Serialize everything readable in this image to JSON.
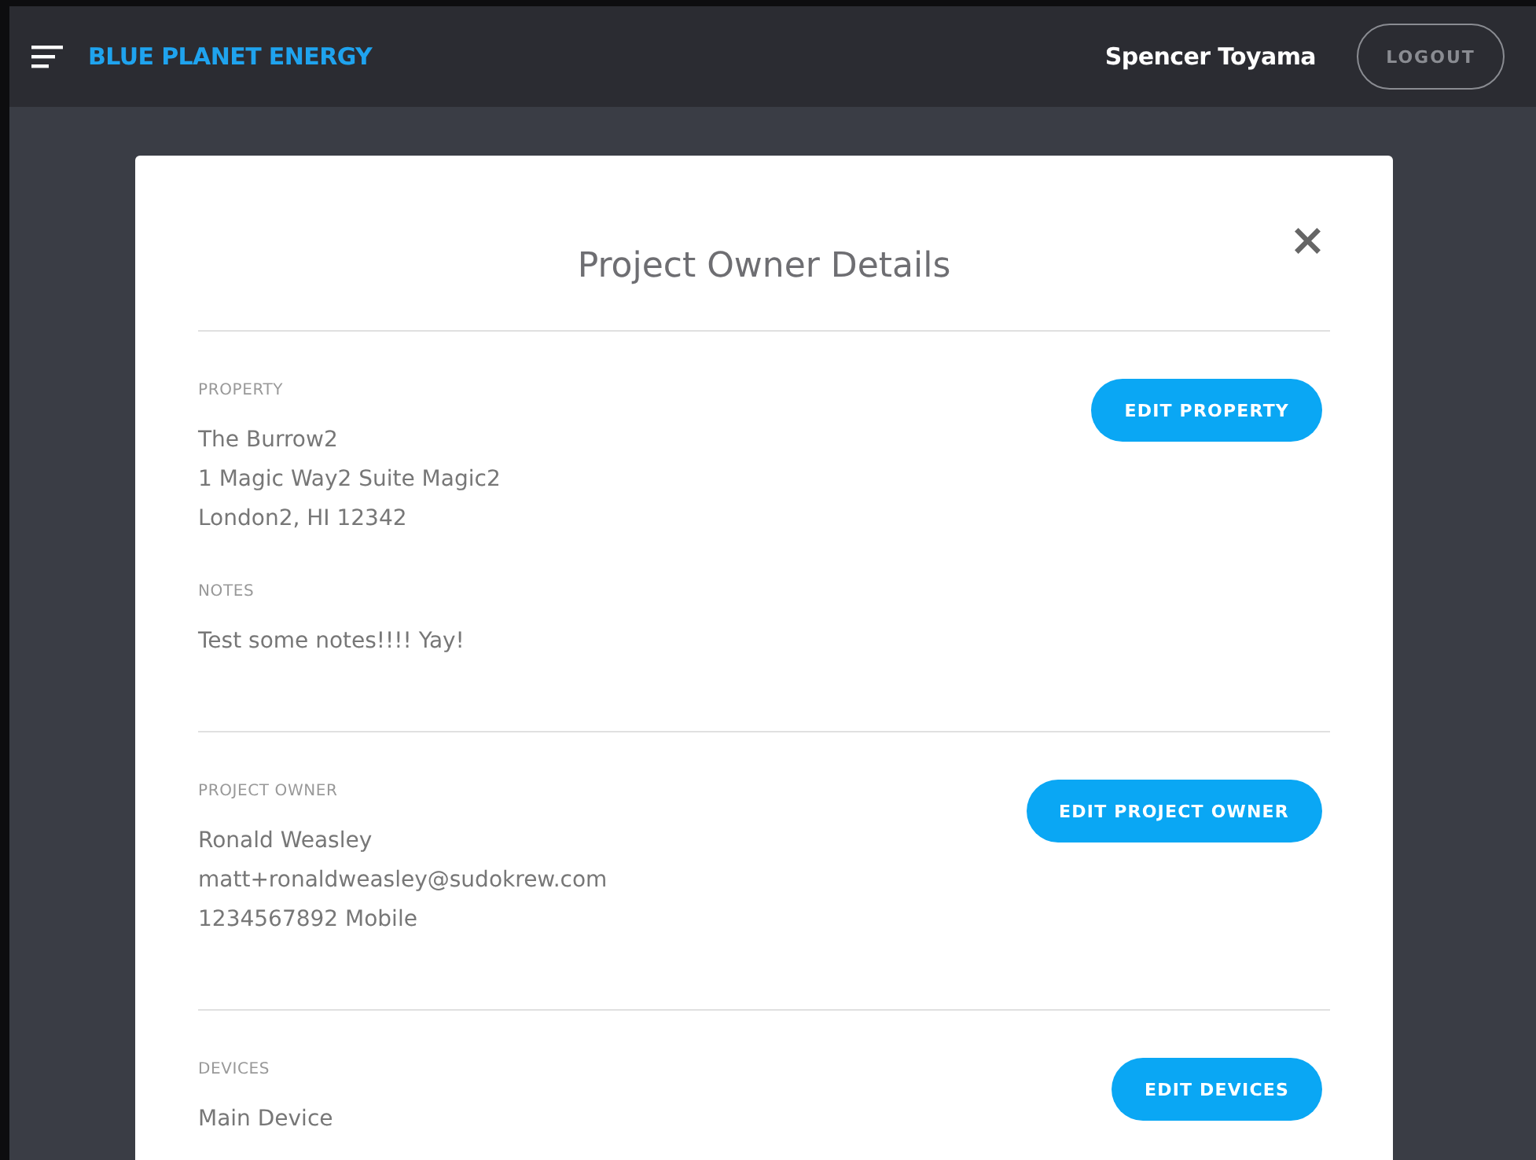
{
  "header": {
    "brand": "BLUE PLANET ENERGY",
    "user": "Spencer Toyama",
    "logout": "LOGOUT"
  },
  "modal": {
    "title": "Project Owner Details",
    "close": "×",
    "sections": [
      {
        "groups": [
          {
            "label": "PROPERTY",
            "lines": [
              "The Burrow2",
              "1 Magic Way2 Suite Magic2",
              "London2, HI 12342"
            ]
          },
          {
            "label": "NOTES",
            "lines": [
              "Test some notes!!!! Yay!"
            ]
          }
        ],
        "button": "EDIT PROPERTY"
      },
      {
        "groups": [
          {
            "label": "PROJECT OWNER",
            "lines": [
              "Ronald Weasley",
              "matt+ronaldweasley@sudokrew.com",
              "1234567892 Mobile"
            ]
          }
        ],
        "button": "EDIT PROJECT OWNER"
      },
      {
        "groups": [
          {
            "label": "DEVICES",
            "lines": [
              "Main Device"
            ]
          }
        ],
        "button": "EDIT DEVICES"
      }
    ]
  }
}
